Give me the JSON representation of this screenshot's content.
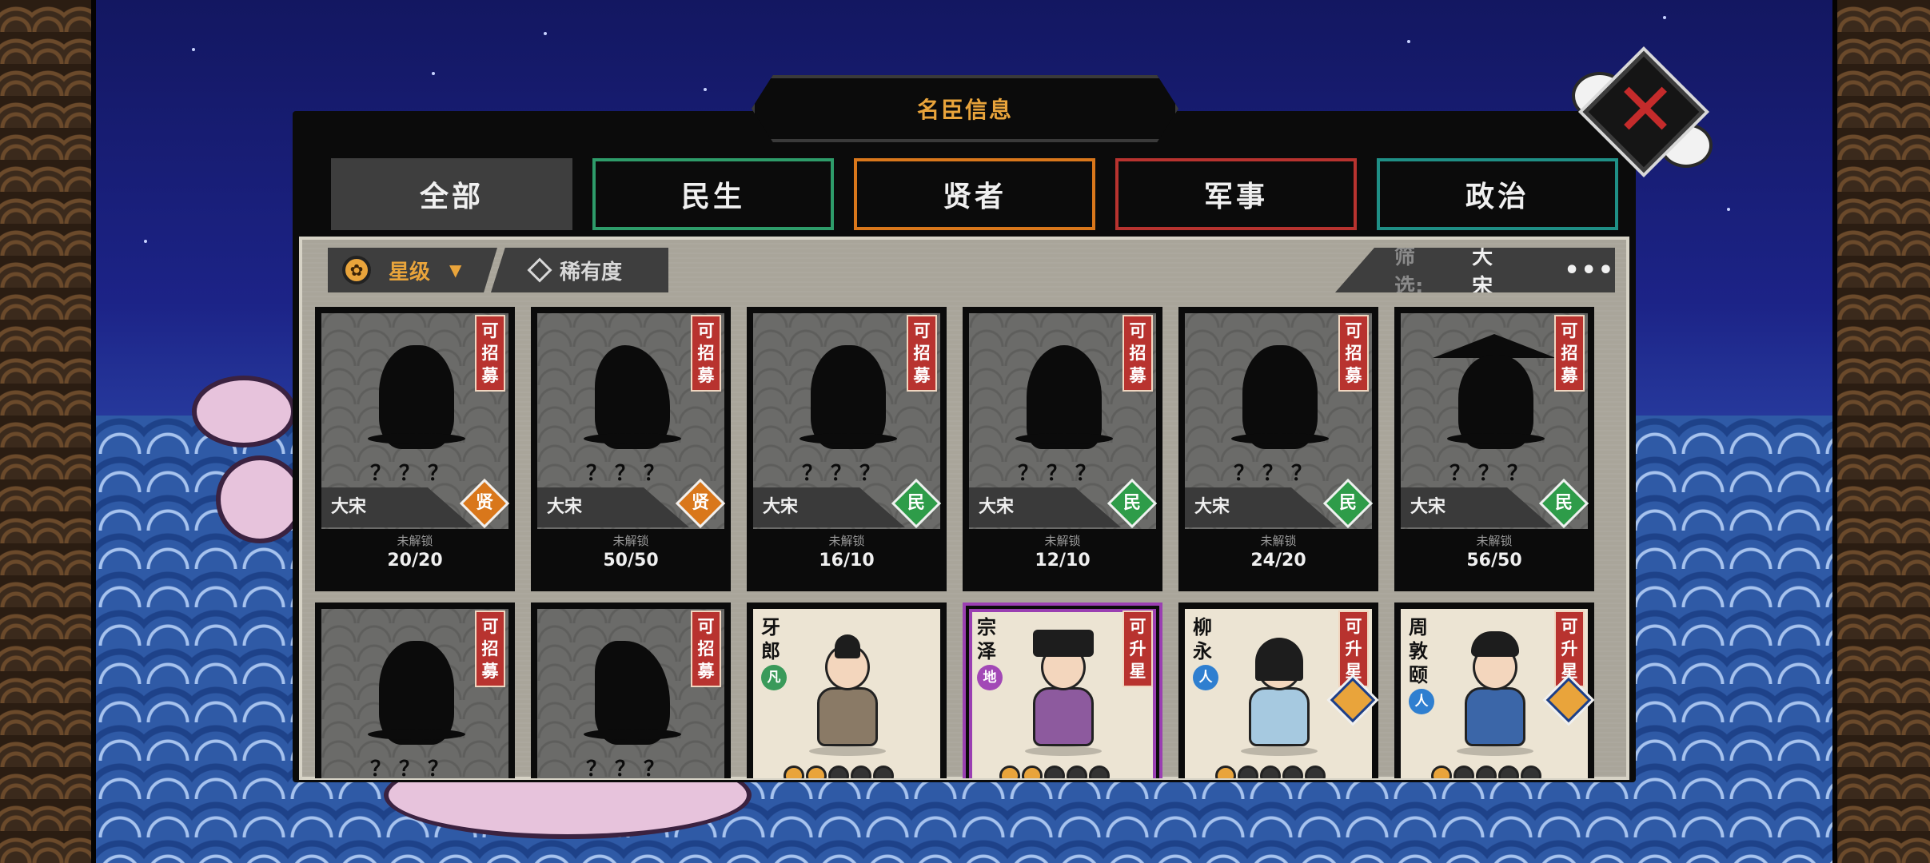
{
  "title": "名臣信息",
  "close_icon": "close-icon",
  "tabs": [
    {
      "label": "全部",
      "color": "#3e3e3e",
      "active": true
    },
    {
      "label": "民生",
      "color": "#2e9c6a",
      "active": false
    },
    {
      "label": "贤者",
      "color": "#d9771b",
      "active": false
    },
    {
      "label": "军事",
      "color": "#b8332f",
      "active": false
    },
    {
      "label": "政治",
      "color": "#1f8f86",
      "active": false
    }
  ],
  "filters": {
    "star_sort": "星级",
    "rarity_sort": "稀有度",
    "filter_label": "筛选:",
    "filter_value": "大宋",
    "more": "•••"
  },
  "locked_status": "未解锁",
  "unknown_name": "？？？",
  "tag_recruit": "可招募",
  "tag_upgrade": "可升星",
  "cards_locked": [
    {
      "nation": "大宋",
      "type": "贤",
      "progress": "20/20"
    },
    {
      "nation": "大宋",
      "type": "贤",
      "progress": "50/50"
    },
    {
      "nation": "大宋",
      "type": "民",
      "progress": "16/10"
    },
    {
      "nation": "大宋",
      "type": "民",
      "progress": "12/10"
    },
    {
      "nation": "大宋",
      "type": "民",
      "progress": "24/20"
    },
    {
      "nation": "大宋",
      "type": "民",
      "progress": "56/50"
    }
  ],
  "cards_row2": [
    {
      "locked": true
    },
    {
      "locked": true
    },
    {
      "locked": false,
      "name": "牙郎",
      "element": "凡",
      "element_color": "#3a9a5a",
      "stars": 2,
      "robe": "#8a7a66",
      "purple": false,
      "rank": false
    },
    {
      "locked": false,
      "name": "宗泽",
      "element": "地",
      "element_color": "#a248b6",
      "stars": 2,
      "robe": "#8d5a9e",
      "purple": true,
      "rank": false
    },
    {
      "locked": false,
      "name": "柳永",
      "element": "人",
      "element_color": "#2f7fd0",
      "stars": 1,
      "robe": "#a6c9e0",
      "purple": false,
      "rank": true
    },
    {
      "locked": false,
      "name": "周敦颐",
      "element": "人",
      "element_color": "#2f7fd0",
      "stars": 1,
      "robe": "#3b66a8",
      "purple": false,
      "rank": true
    }
  ]
}
